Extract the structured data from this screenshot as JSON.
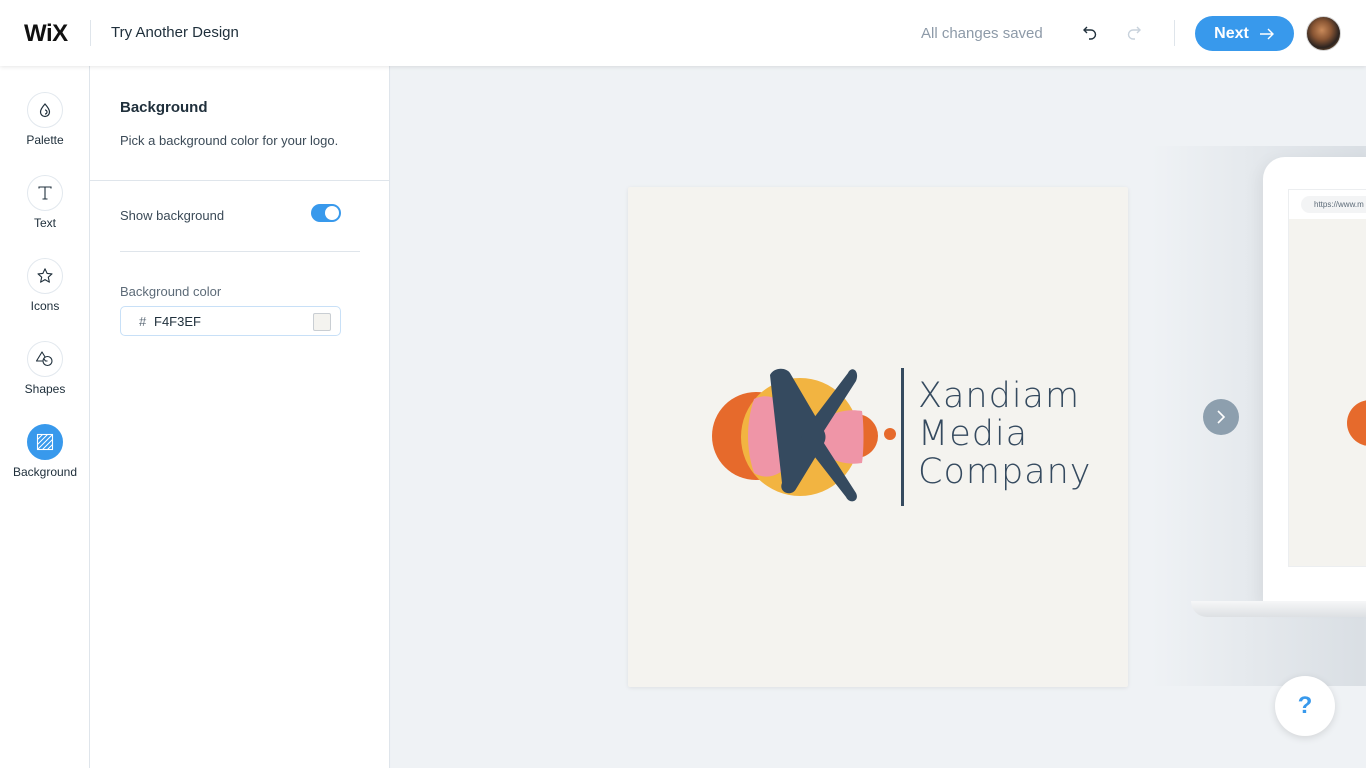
{
  "header": {
    "brand": "WiX",
    "try_another_label": "Try Another Design",
    "save_status": "All changes saved",
    "undo_icon": "undo-icon",
    "redo_icon": "redo-icon",
    "next_label": "Next",
    "next_icon": "arrow-right-icon",
    "avatar_icon": "user-avatar"
  },
  "rail": {
    "items": [
      {
        "label": "Palette",
        "icon": "drop-icon",
        "active": false
      },
      {
        "label": "Text",
        "icon": "text-t-icon",
        "active": false
      },
      {
        "label": "Icons",
        "icon": "star-icon",
        "active": false
      },
      {
        "label": "Shapes",
        "icon": "shapes-icon",
        "active": false
      },
      {
        "label": "Background",
        "icon": "background-hatch-icon",
        "active": true
      }
    ]
  },
  "panel": {
    "title": "Background",
    "description": "Pick a background color for your logo.",
    "show_background_label": "Show background",
    "show_background_on": true,
    "background_color_label": "Background color",
    "hash": "#",
    "background_color_value": "F4F3EF"
  },
  "canvas": {
    "logo": {
      "line1": "Xandiam",
      "line2": "Media",
      "line3": "Company",
      "colors": {
        "background": "#F4F3EF",
        "orange": "#E66A2C",
        "yellow": "#F2B441",
        "pink": "#EF95A7",
        "navy": "#354A5F"
      }
    },
    "next_design_icon": "chevron-right-icon",
    "mockup_url": "https://www.m",
    "help_label": "?"
  },
  "colors": {
    "accent": "#3899EC",
    "rail_border": "#DFE5EB",
    "canvas_bg": "#EFF2F5"
  }
}
